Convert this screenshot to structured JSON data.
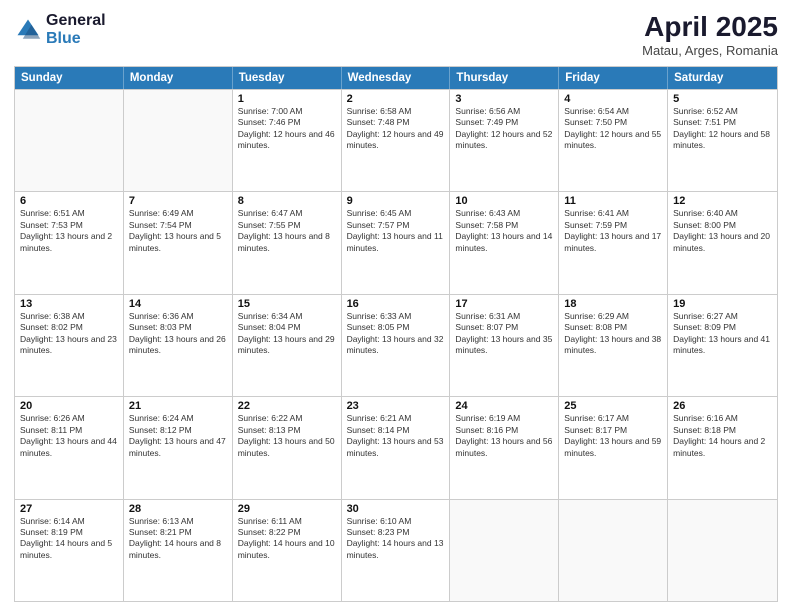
{
  "logo": {
    "general": "General",
    "blue": "Blue"
  },
  "title": "April 2025",
  "location": "Matau, Arges, Romania",
  "weekdays": [
    "Sunday",
    "Monday",
    "Tuesday",
    "Wednesday",
    "Thursday",
    "Friday",
    "Saturday"
  ],
  "weeks": [
    [
      {
        "day": "",
        "empty": true
      },
      {
        "day": "",
        "empty": true
      },
      {
        "day": "1",
        "sunrise": "Sunrise: 7:00 AM",
        "sunset": "Sunset: 7:46 PM",
        "daylight": "Daylight: 12 hours and 46 minutes."
      },
      {
        "day": "2",
        "sunrise": "Sunrise: 6:58 AM",
        "sunset": "Sunset: 7:48 PM",
        "daylight": "Daylight: 12 hours and 49 minutes."
      },
      {
        "day": "3",
        "sunrise": "Sunrise: 6:56 AM",
        "sunset": "Sunset: 7:49 PM",
        "daylight": "Daylight: 12 hours and 52 minutes."
      },
      {
        "day": "4",
        "sunrise": "Sunrise: 6:54 AM",
        "sunset": "Sunset: 7:50 PM",
        "daylight": "Daylight: 12 hours and 55 minutes."
      },
      {
        "day": "5",
        "sunrise": "Sunrise: 6:52 AM",
        "sunset": "Sunset: 7:51 PM",
        "daylight": "Daylight: 12 hours and 58 minutes."
      }
    ],
    [
      {
        "day": "6",
        "sunrise": "Sunrise: 6:51 AM",
        "sunset": "Sunset: 7:53 PM",
        "daylight": "Daylight: 13 hours and 2 minutes."
      },
      {
        "day": "7",
        "sunrise": "Sunrise: 6:49 AM",
        "sunset": "Sunset: 7:54 PM",
        "daylight": "Daylight: 13 hours and 5 minutes."
      },
      {
        "day": "8",
        "sunrise": "Sunrise: 6:47 AM",
        "sunset": "Sunset: 7:55 PM",
        "daylight": "Daylight: 13 hours and 8 minutes."
      },
      {
        "day": "9",
        "sunrise": "Sunrise: 6:45 AM",
        "sunset": "Sunset: 7:57 PM",
        "daylight": "Daylight: 13 hours and 11 minutes."
      },
      {
        "day": "10",
        "sunrise": "Sunrise: 6:43 AM",
        "sunset": "Sunset: 7:58 PM",
        "daylight": "Daylight: 13 hours and 14 minutes."
      },
      {
        "day": "11",
        "sunrise": "Sunrise: 6:41 AM",
        "sunset": "Sunset: 7:59 PM",
        "daylight": "Daylight: 13 hours and 17 minutes."
      },
      {
        "day": "12",
        "sunrise": "Sunrise: 6:40 AM",
        "sunset": "Sunset: 8:00 PM",
        "daylight": "Daylight: 13 hours and 20 minutes."
      }
    ],
    [
      {
        "day": "13",
        "sunrise": "Sunrise: 6:38 AM",
        "sunset": "Sunset: 8:02 PM",
        "daylight": "Daylight: 13 hours and 23 minutes."
      },
      {
        "day": "14",
        "sunrise": "Sunrise: 6:36 AM",
        "sunset": "Sunset: 8:03 PM",
        "daylight": "Daylight: 13 hours and 26 minutes."
      },
      {
        "day": "15",
        "sunrise": "Sunrise: 6:34 AM",
        "sunset": "Sunset: 8:04 PM",
        "daylight": "Daylight: 13 hours and 29 minutes."
      },
      {
        "day": "16",
        "sunrise": "Sunrise: 6:33 AM",
        "sunset": "Sunset: 8:05 PM",
        "daylight": "Daylight: 13 hours and 32 minutes."
      },
      {
        "day": "17",
        "sunrise": "Sunrise: 6:31 AM",
        "sunset": "Sunset: 8:07 PM",
        "daylight": "Daylight: 13 hours and 35 minutes."
      },
      {
        "day": "18",
        "sunrise": "Sunrise: 6:29 AM",
        "sunset": "Sunset: 8:08 PM",
        "daylight": "Daylight: 13 hours and 38 minutes."
      },
      {
        "day": "19",
        "sunrise": "Sunrise: 6:27 AM",
        "sunset": "Sunset: 8:09 PM",
        "daylight": "Daylight: 13 hours and 41 minutes."
      }
    ],
    [
      {
        "day": "20",
        "sunrise": "Sunrise: 6:26 AM",
        "sunset": "Sunset: 8:11 PM",
        "daylight": "Daylight: 13 hours and 44 minutes."
      },
      {
        "day": "21",
        "sunrise": "Sunrise: 6:24 AM",
        "sunset": "Sunset: 8:12 PM",
        "daylight": "Daylight: 13 hours and 47 minutes."
      },
      {
        "day": "22",
        "sunrise": "Sunrise: 6:22 AM",
        "sunset": "Sunset: 8:13 PM",
        "daylight": "Daylight: 13 hours and 50 minutes."
      },
      {
        "day": "23",
        "sunrise": "Sunrise: 6:21 AM",
        "sunset": "Sunset: 8:14 PM",
        "daylight": "Daylight: 13 hours and 53 minutes."
      },
      {
        "day": "24",
        "sunrise": "Sunrise: 6:19 AM",
        "sunset": "Sunset: 8:16 PM",
        "daylight": "Daylight: 13 hours and 56 minutes."
      },
      {
        "day": "25",
        "sunrise": "Sunrise: 6:17 AM",
        "sunset": "Sunset: 8:17 PM",
        "daylight": "Daylight: 13 hours and 59 minutes."
      },
      {
        "day": "26",
        "sunrise": "Sunrise: 6:16 AM",
        "sunset": "Sunset: 8:18 PM",
        "daylight": "Daylight: 14 hours and 2 minutes."
      }
    ],
    [
      {
        "day": "27",
        "sunrise": "Sunrise: 6:14 AM",
        "sunset": "Sunset: 8:19 PM",
        "daylight": "Daylight: 14 hours and 5 minutes."
      },
      {
        "day": "28",
        "sunrise": "Sunrise: 6:13 AM",
        "sunset": "Sunset: 8:21 PM",
        "daylight": "Daylight: 14 hours and 8 minutes."
      },
      {
        "day": "29",
        "sunrise": "Sunrise: 6:11 AM",
        "sunset": "Sunset: 8:22 PM",
        "daylight": "Daylight: 14 hours and 10 minutes."
      },
      {
        "day": "30",
        "sunrise": "Sunrise: 6:10 AM",
        "sunset": "Sunset: 8:23 PM",
        "daylight": "Daylight: 14 hours and 13 minutes."
      },
      {
        "day": "",
        "empty": true
      },
      {
        "day": "",
        "empty": true
      },
      {
        "day": "",
        "empty": true
      }
    ]
  ]
}
